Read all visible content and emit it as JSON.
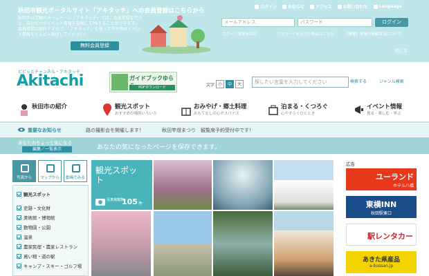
{
  "top": {
    "link": "秋田市観光ポータルサイト「アキタッチ」への会員登録はこちらから",
    "desc": "秋田市公式観光ホームページ「アキタッチ」では、会員登録を行うと、自分だけのイベント情報を投稿してPRすることができます。会員登録は無料ですので、「アキタッチ」を使って今や旬のイベント情報をどんどん発信してください！",
    "register": "無料会員登録",
    "nav": [
      "ログイン",
      "お知らせ",
      "アクセス",
      "お問い合わせ",
      "Language"
    ],
    "mail_placeholder": "メールアドレス",
    "pass_placeholder": "パスワード",
    "login": "ログイン",
    "keep": "ログイン状態を保存",
    "forgot": "パスワードを忘れた場合はこちら",
    "info_note": "【要要】情報の掲載状況について",
    "close": "閉じる"
  },
  "head": {
    "tagline": "ビビッとチャンネル・アキタッチ",
    "logo": "Akitachi",
    "guide_title": "ガイドブックゆらら",
    "guide_dl": "PDFダウンロード",
    "fontsize_label": "文字",
    "sizes": [
      "小",
      "中",
      "大"
    ],
    "search_placeholder": "探したい言葉を入力してください",
    "search_btn": "検索する",
    "genre_btn": "ジャンル検索"
  },
  "mainnav": [
    {
      "label": "秋田市の紹介",
      "sub": ""
    },
    {
      "label": "観光スポット",
      "sub": "おすすめの場所いろいろ"
    },
    {
      "label": "おみやげ・郷土料理",
      "sub": "おもてなしの心がスパイス"
    },
    {
      "label": "泊まる・くつろぐ",
      "sub": "心やすらぐひととき"
    },
    {
      "label": "イベント情報",
      "sub": "見る・楽しむ・学ぶ"
    }
  ],
  "notice": {
    "label": "重要なお知らせ",
    "items": [
      "路の撮影会を開催します！",
      "秋田竿燈まつり　観覧席予約受付中です！"
    ]
  },
  "save": {
    "chotto": "あなたのちょっと気になる",
    "edit": "編集／一覧表示",
    "message": "あなたの気になったページを保存できます。"
  },
  "tabs": [
    "写真から",
    "マップから",
    "動画でみる"
  ],
  "cat_header": "観光スポット",
  "categories": [
    "史跡・文化財",
    "美術館・博物館",
    "動物園・公園",
    "温泉",
    "農家民宿・農家レストラン",
    "買い物・道の駅",
    "キャンプ・スキー・ゴルフ場"
  ],
  "spot": {
    "title": "観光スポット",
    "sub": "写真掲載数",
    "count": "105",
    "unit": "件"
  },
  "ads_header": "広告",
  "ads": [
    {
      "title": "ユーランド",
      "sub": "ホテル八橋",
      "color": "#e8381b"
    },
    {
      "title": "東横INN",
      "sub": "秋田駅東口",
      "color": "#1a4c8a"
    },
    {
      "title": "駅レンタカー",
      "sub": "",
      "color": "#d3202c"
    },
    {
      "title": "あきた県産品",
      "sub": "a-bussan.jp",
      "color": "#f3d300"
    }
  ]
}
